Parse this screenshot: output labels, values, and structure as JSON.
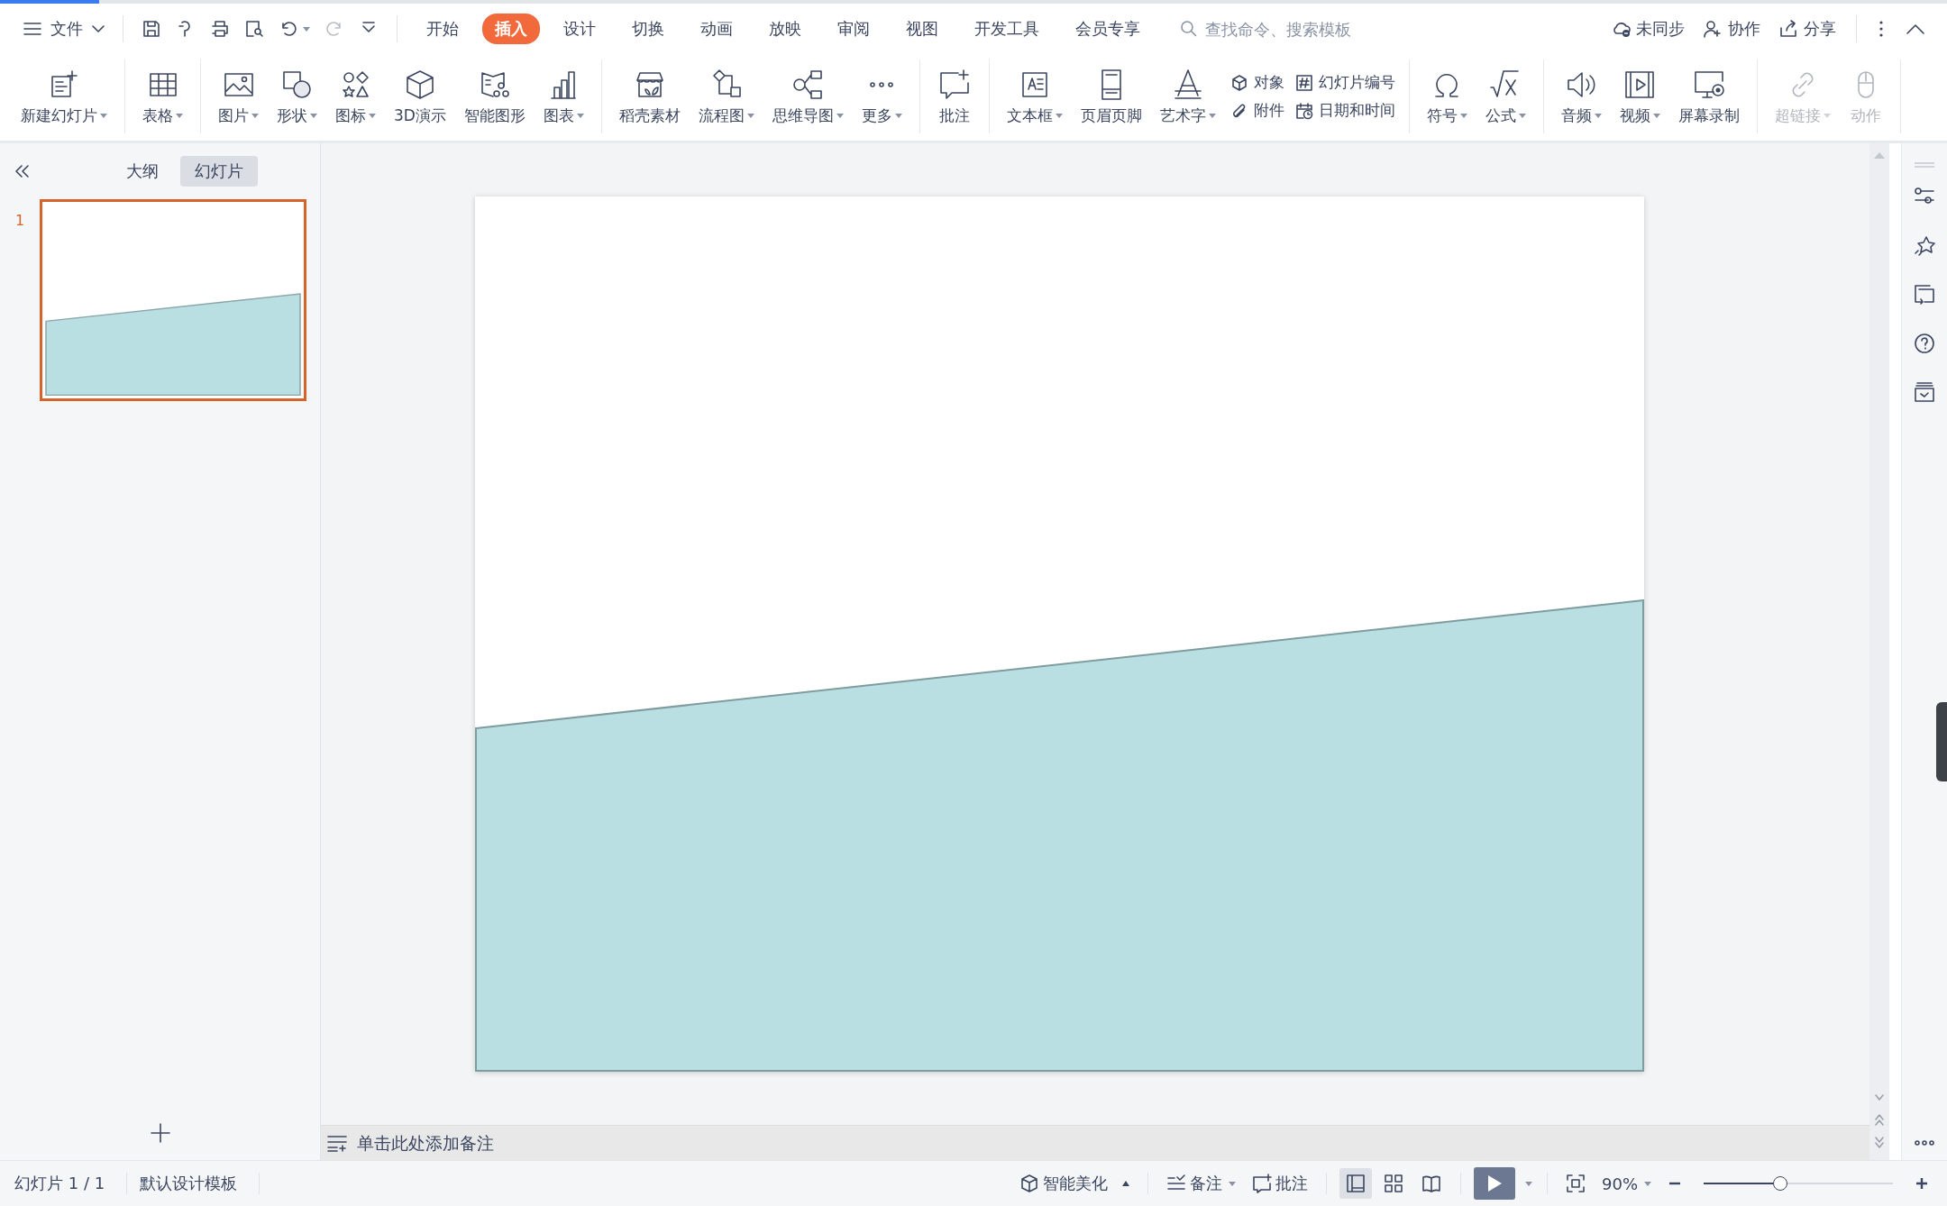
{
  "menu_bar": {
    "file_menu": "文件",
    "quick_access": [
      {
        "disabled": false,
        "dropdown": false
      },
      {
        "disabled": false,
        "dropdown": false
      },
      {
        "disabled": false,
        "dropdown": false
      },
      {
        "disabled": false,
        "dropdown": false
      },
      {
        "disabled": false,
        "dropdown": true
      },
      {
        "disabled": true,
        "dropdown": false
      },
      {
        "disabled": false,
        "dropdown": false
      }
    ],
    "tabs": [
      {
        "label": "开始",
        "selected": false
      },
      {
        "label": "插入",
        "selected": true
      },
      {
        "label": "设计",
        "selected": false
      },
      {
        "label": "切换",
        "selected": false
      },
      {
        "label": "动画",
        "selected": false
      },
      {
        "label": "放映",
        "selected": false
      },
      {
        "label": "审阅",
        "selected": false
      },
      {
        "label": "视图",
        "selected": false
      },
      {
        "label": "开发工具",
        "selected": false
      },
      {
        "label": "会员专享",
        "selected": false
      }
    ],
    "search": {
      "placeholder": "查找命令、搜索模板"
    },
    "actions": [
      "未同步",
      "协作",
      "分享"
    ]
  },
  "ribbon": {
    "groups": [
      {
        "items": [
          {
            "kind": "big",
            "label": "新建幻灯片",
            "dropdown": true,
            "disabled": false
          }
        ]
      },
      {
        "items": [
          {
            "kind": "big",
            "label": "表格",
            "dropdown": true,
            "disabled": false
          }
        ]
      },
      {
        "items": [
          {
            "kind": "big",
            "label": "图片",
            "dropdown": true,
            "disabled": false
          },
          {
            "kind": "big",
            "label": "形状",
            "dropdown": true,
            "disabled": false
          },
          {
            "kind": "big",
            "label": "图标",
            "dropdown": true,
            "disabled": false
          },
          {
            "kind": "big",
            "label": "3D演示",
            "dropdown": false,
            "disabled": false
          },
          {
            "kind": "big",
            "label": "智能图形",
            "dropdown": false,
            "disabled": false
          },
          {
            "kind": "big",
            "label": "图表",
            "dropdown": true,
            "disabled": false
          }
        ]
      },
      {
        "items": [
          {
            "kind": "big",
            "label": "稻壳素材",
            "dropdown": false,
            "disabled": false
          },
          {
            "kind": "big",
            "label": "流程图",
            "dropdown": true,
            "disabled": false
          },
          {
            "kind": "big",
            "label": "思维导图",
            "dropdown": true,
            "disabled": false
          },
          {
            "kind": "big",
            "label": "更多",
            "dropdown": true,
            "disabled": false
          }
        ]
      },
      {
        "items": [
          {
            "kind": "big",
            "label": "批注",
            "dropdown": false,
            "disabled": false
          }
        ]
      },
      {
        "items": [
          {
            "kind": "big",
            "label": "文本框",
            "dropdown": true,
            "disabled": false
          },
          {
            "kind": "big",
            "label": "页眉页脚",
            "dropdown": false,
            "disabled": false
          },
          {
            "kind": "big",
            "label": "艺术字",
            "dropdown": true,
            "disabled": false
          },
          {
            "kind": "pair",
            "items": [
              {
                "label": "对象"
              },
              {
                "label": "附件"
              }
            ]
          },
          {
            "kind": "pair",
            "items": [
              {
                "label": "幻灯片编号"
              },
              {
                "label": "日期和时间"
              }
            ]
          }
        ]
      },
      {
        "items": [
          {
            "kind": "big",
            "label": "符号",
            "dropdown": true,
            "disabled": false
          },
          {
            "kind": "big",
            "label": "公式",
            "dropdown": true,
            "disabled": false
          }
        ]
      },
      {
        "items": [
          {
            "kind": "big",
            "label": "音频",
            "dropdown": true,
            "disabled": false
          },
          {
            "kind": "big",
            "label": "视频",
            "dropdown": true,
            "disabled": false
          },
          {
            "kind": "big",
            "label": "屏幕录制",
            "dropdown": false,
            "disabled": false
          }
        ]
      },
      {
        "items": [
          {
            "kind": "big",
            "label": "超链接",
            "dropdown": true,
            "disabled": true
          },
          {
            "kind": "big",
            "label": "动作",
            "dropdown": false,
            "disabled": true
          }
        ]
      }
    ]
  },
  "left_panel": {
    "tabs": [
      {
        "label": "大纲",
        "selected": false
      },
      {
        "label": "幻灯片",
        "selected": true
      }
    ],
    "slides": [
      {
        "number": "1",
        "selected": true
      }
    ]
  },
  "notes": {
    "placeholder": "单击此处添加备注"
  },
  "status_bar": {
    "slide_info": "幻灯片 1 / 1",
    "template": "默认设计模板",
    "beautify": "智能美化",
    "notes": "备注",
    "comments": "批注",
    "views": [
      {
        "selected": true
      },
      {
        "selected": false
      },
      {
        "selected": false
      }
    ],
    "zoom": "90%",
    "zoom_slider": {
      "level": 0.41
    }
  }
}
